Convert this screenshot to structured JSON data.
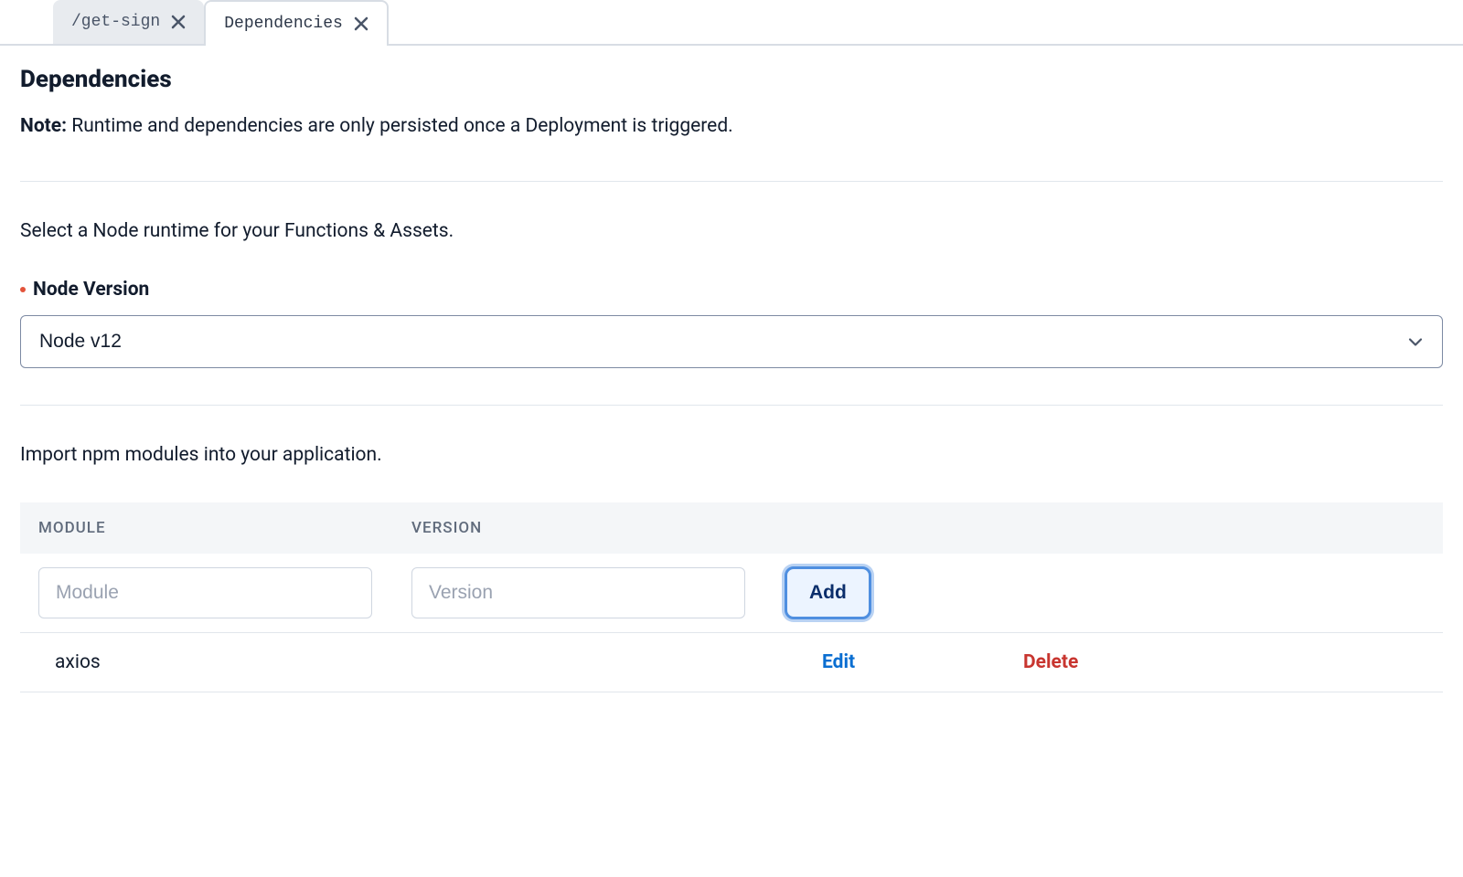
{
  "tabs": [
    {
      "label": "/get-sign",
      "active": false
    },
    {
      "label": "Dependencies",
      "active": true
    }
  ],
  "page": {
    "title": "Dependencies",
    "note_label": "Note:",
    "note_text": "Runtime and dependencies are only persisted once a Deployment is triggered.",
    "runtime_desc": "Select a Node runtime for your Functions & Assets.",
    "node_version_label": "Node Version",
    "node_version_value": "Node v12",
    "import_desc": "Import npm modules into your application."
  },
  "table": {
    "headers": {
      "module": "MODULE",
      "version": "VERSION"
    },
    "inputs": {
      "module_placeholder": "Module",
      "version_placeholder": "Version",
      "add_label": "Add"
    },
    "rows": [
      {
        "module": "axios",
        "version": "",
        "edit_label": "Edit",
        "delete_label": "Delete"
      }
    ]
  }
}
